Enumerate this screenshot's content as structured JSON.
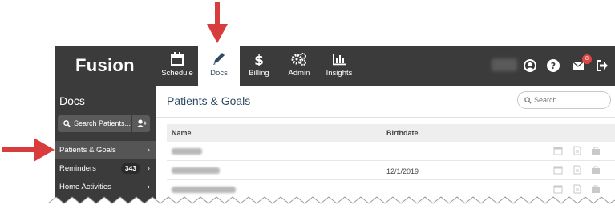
{
  "app": {
    "logo": "Fusion",
    "nav": [
      {
        "label": "Schedule",
        "icon": "calendar-icon",
        "active": false
      },
      {
        "label": "Docs",
        "icon": "pencil-icon",
        "active": true
      },
      {
        "label": "Billing",
        "icon": "dollar-icon",
        "active": false
      },
      {
        "label": "Admin",
        "icon": "gears-icon",
        "active": false
      },
      {
        "label": "Insights",
        "icon": "bar-chart-icon",
        "active": false
      }
    ],
    "notifications_count": "8"
  },
  "sidebar": {
    "title": "Docs",
    "search_label": "Search Patients...",
    "items": [
      {
        "label": "Patients & Goals",
        "active": true
      },
      {
        "label": "Reminders",
        "count": "343"
      },
      {
        "label": "Home Activities"
      }
    ]
  },
  "main": {
    "title": "Patients & Goals",
    "search_placeholder": "Search...",
    "columns": [
      "Name",
      "Birthdate"
    ],
    "rows": [
      {
        "birthdate": ""
      },
      {
        "birthdate": "12/1/2019"
      },
      {
        "birthdate": ""
      }
    ]
  },
  "colors": {
    "nav_bg": "#3b3b3b",
    "accent": "#2e4a66",
    "arrow": "#d93c3c",
    "badge": "#e04444"
  }
}
